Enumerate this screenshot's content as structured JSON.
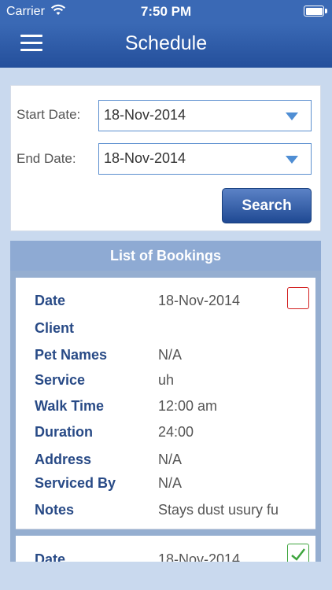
{
  "status_bar": {
    "carrier": "Carrier",
    "time": "7:50 PM",
    "wifi_icon": "wifi-icon",
    "battery_icon": "battery-icon"
  },
  "nav": {
    "title": "Schedule",
    "menu_icon": "hamburger-menu-icon",
    "color": "#2f5ea8"
  },
  "search": {
    "start_label": "Start Date:",
    "start_value": "18-Nov-2014",
    "end_label": "End Date:",
    "end_value": "18-Nov-2014",
    "button_label": "Search",
    "dropdown_icon": "caret-down-icon"
  },
  "bookings": {
    "header": "List of Bookings",
    "items": [
      {
        "date_label": "Date",
        "date": "18-Nov-2014",
        "client_label": "Client",
        "client": "",
        "pets_label": "Pet Names",
        "pets": "N/A",
        "service_label": "Service",
        "service": "uh",
        "walk_time_label": "Walk Time",
        "walk_time": "12:00 am",
        "duration_label": "Duration",
        "duration": "24:00",
        "address_label": "Address",
        "address": "N/A",
        "serviced_by_label": "Serviced By",
        "serviced_by": "N/A",
        "notes_label": "Notes",
        "notes": "Stays dust usury fu",
        "completed": false
      },
      {
        "date_label": "Date",
        "date": "18-Nov-2014",
        "completed": true
      }
    ]
  },
  "colors": {
    "accent": "#2f5ea8",
    "background": "#c9d9ee",
    "label_text": "#284a86",
    "checkbox_unchecked": "#d21f1f",
    "checkbox_checked": "#3fa53f"
  }
}
